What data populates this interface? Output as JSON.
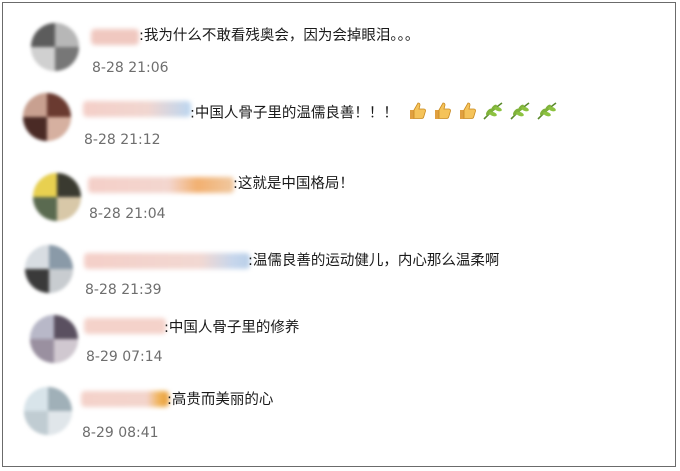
{
  "comments": [
    {
      "text": ":我为什么不敢看残奥会，因为会掉眼泪。。。",
      "time": "8-28 21:06"
    },
    {
      "text": ":中国人骨子里的温儒良善！！！",
      "time": "8-28 21:12",
      "emoji": [
        "thumbs-up",
        "thumbs-up",
        "thumbs-up",
        "olive-branch",
        "olive-branch",
        "olive-branch"
      ]
    },
    {
      "text": ":这就是中国格局！",
      "time": "8-28 21:04"
    },
    {
      "text": ":温儒良善的运动健儿，内心那么温柔啊",
      "time": "8-28 21:39"
    },
    {
      "text": ":中国人骨子里的修养",
      "time": "8-29 07:14"
    },
    {
      "text": ":高贵而美丽的心",
      "time": "8-29 08:41"
    }
  ]
}
